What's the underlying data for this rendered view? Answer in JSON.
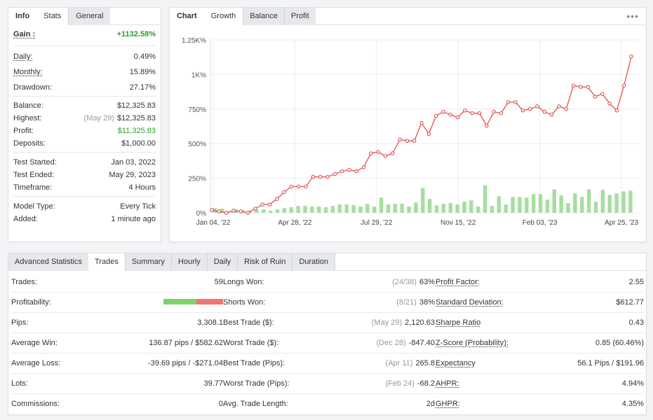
{
  "info_tabs": [
    "Info",
    "Stats",
    "General"
  ],
  "info": {
    "gain_label": "Gain :",
    "gain_value": "+1132.58%",
    "daily_label": "Daily:",
    "daily_value": "0.49%",
    "monthly_label": "Monthly:",
    "monthly_value": "15.89%",
    "drawdown_label": "Drawdown:",
    "drawdown_value": "27.17%",
    "balance_label": "Balance:",
    "balance_value": "$12,325.83",
    "highest_label": "Highest:",
    "highest_date": "(May 29)",
    "highest_value": "$12,325.83",
    "profit_label": "Profit:",
    "profit_value": "$11,325.83",
    "deposits_label": "Deposits:",
    "deposits_value": "$1,000.00",
    "test_started_label": "Test Started:",
    "test_started_value": "Jan 03, 2022",
    "test_ended_label": "Test Ended:",
    "test_ended_value": "May 29, 2023",
    "timeframe_label": "Timeframe:",
    "timeframe_value": "4 Hours",
    "model_type_label": "Model Type:",
    "model_type_value": "Every Tick",
    "added_label": "Added:",
    "added_value": "1 minute ago"
  },
  "chart_tabs": [
    "Chart",
    "Growth",
    "Balance",
    "Profit"
  ],
  "chart_menu": "•••",
  "colors": {
    "line": "#e0504f",
    "bar": "#a6dea0",
    "gain": "#2ca02c",
    "bar_profit_green": "#7ed36b",
    "bar_profit_red": "#f27474"
  },
  "chart_data": {
    "type": "line",
    "x_ticks": [
      "Jan 04, '22",
      "Apr 28, '22",
      "Jul 29, '22",
      "Nov 15, '22",
      "Feb 03, '23",
      "Apr 25, '23"
    ],
    "y_ticks": [
      "0%",
      "250%",
      "500%",
      "750%",
      "1K%",
      "1.25K%"
    ],
    "ylim": [
      0,
      1250
    ],
    "grid": true,
    "series": [
      {
        "values": [
          20,
          10,
          0,
          15,
          10,
          0,
          30,
          60,
          60,
          100,
          150,
          190,
          190,
          190,
          260,
          260,
          260,
          280,
          300,
          310,
          300,
          330,
          430,
          440,
          410,
          430,
          530,
          520,
          520,
          650,
          570,
          700,
          730,
          710,
          690,
          740,
          720,
          720,
          630,
          730,
          720,
          800,
          800,
          740,
          750,
          770,
          730,
          710,
          770,
          750,
          920,
          910,
          910,
          840,
          860,
          790,
          740,
          920,
          1130
        ]
      },
      {
        "values": [
          35,
          30,
          10,
          25,
          20,
          15,
          25,
          25,
          15,
          25,
          35,
          40,
          50,
          50,
          45,
          45,
          40,
          50,
          60,
          60,
          55,
          45,
          65,
          45,
          110,
          60,
          65,
          65,
          45,
          75,
          180,
          100,
          55,
          65,
          70,
          60,
          80,
          90,
          45,
          200,
          50,
          120,
          60,
          115,
          115,
          110,
          135,
          135,
          95,
          170,
          125,
          70,
          140,
          115,
          170,
          80,
          165,
          130,
          140,
          155,
          160
        ]
      }
    ]
  },
  "adv_tabs": [
    "Advanced Statistics",
    "Trades",
    "Summary",
    "Hourly",
    "Daily",
    "Risk of Ruin",
    "Duration"
  ],
  "stats": {
    "col1": [
      {
        "label": "Trades:",
        "value": "59"
      },
      {
        "label": "Profitability:",
        "value": "",
        "profitability_win_fraction": 0.55
      },
      {
        "label": "Pips:",
        "value": "3,308.1"
      },
      {
        "label": "Average Win:",
        "value": "136.87 pips / $582.62"
      },
      {
        "label": "Average Loss:",
        "value": "-39.69 pips / -$271.04"
      },
      {
        "label": "Lots:",
        "value": "39.77"
      },
      {
        "label": "Commissions:",
        "value": "0"
      }
    ],
    "col2": [
      {
        "label": "Longs Won:",
        "pre": "(24/38)",
        "value": "63%"
      },
      {
        "label": "Shorts Won:",
        "pre": "(8/21)",
        "value": "38%"
      },
      {
        "label": "Best Trade ($):",
        "pre": "(May 29)",
        "value": "2,120.63"
      },
      {
        "label": "Worst Trade ($):",
        "pre": "(Dec 28)",
        "value": "-847.40"
      },
      {
        "label": "Best Trade (Pips):",
        "pre": "(Apr 11)",
        "value": "265.8"
      },
      {
        "label": "Worst Trade (Pips):",
        "pre": "(Feb 24)",
        "value": "-68.2"
      },
      {
        "label": "Avg. Trade Length:",
        "pre": "",
        "value": "2d"
      }
    ],
    "col3": [
      {
        "label": "Profit Factor:",
        "value": "2.55"
      },
      {
        "label": "Standard Deviation:",
        "value": "$612.77"
      },
      {
        "label": "Sharpe Ratio",
        "value": "0.43"
      },
      {
        "label": "Z-Score (Probability):",
        "value": "0.85 (60.46%)"
      },
      {
        "label": "Expectancy",
        "value": "56.1 Pips / $191.96"
      },
      {
        "label": "AHPR:",
        "value": "4.94%"
      },
      {
        "label": "GHPR:",
        "value": "4.35%"
      }
    ]
  }
}
